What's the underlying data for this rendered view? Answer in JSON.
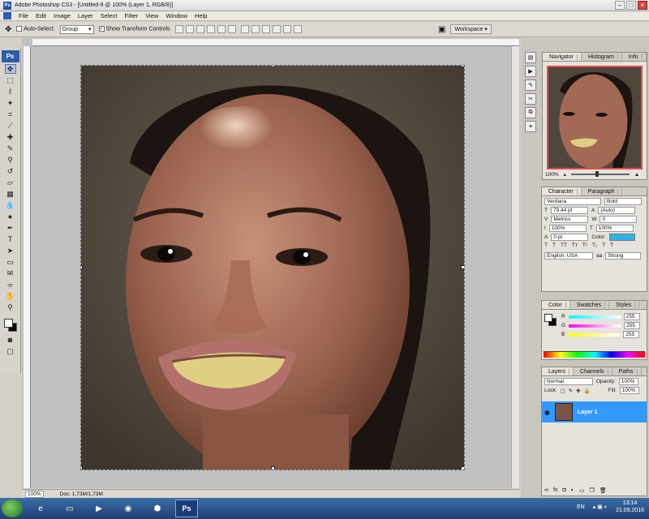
{
  "window": {
    "title": "Adobe Photoshop CS3 - [Untitled-9 @ 100% (Layer 1, RGB/8)]",
    "minimize": "–",
    "maximize": "□",
    "close": "×"
  },
  "menu": [
    "File",
    "Edit",
    "Image",
    "Layer",
    "Select",
    "Filter",
    "View",
    "Window",
    "Help"
  ],
  "options": {
    "auto_select": "Auto-Select:",
    "auto_select_value": "Group",
    "show_transform": "Show Transform Controls",
    "workspace": "Workspace"
  },
  "toolbox": {
    "badge": "Ps"
  },
  "statusbar": {
    "zoom": "100%",
    "doc": "Doc: 1,73M/1,73M"
  },
  "navigator": {
    "tabs": [
      "Navigator",
      "Histogram",
      "Info"
    ],
    "zoom": "100%"
  },
  "character": {
    "tabs": [
      "Character",
      "Paragraph"
    ],
    "font": "Verdana",
    "style": "Bold",
    "size": "79,44 pt",
    "leading": "(Auto)",
    "kerning": "Metrics",
    "tracking": "0",
    "v_scale": "100%",
    "h_scale": "100%",
    "baseline": "0 pt",
    "color_label": "Color:",
    "color_value": "#2bb3ea",
    "language": "English: USA",
    "aa": "Strong",
    "aa_prefix": "aa"
  },
  "color": {
    "tabs": [
      "Color",
      "Swatches",
      "Styles"
    ],
    "r_label": "R",
    "g_label": "G",
    "b_label": "B",
    "r": "255",
    "g": "255",
    "b": "255"
  },
  "layers": {
    "tabs": [
      "Layers",
      "Channels",
      "Paths"
    ],
    "blend": "Normal",
    "opacity_label": "Opacity:",
    "opacity": "100%",
    "lock_label": "Lock:",
    "fill_label": "Fill:",
    "fill": "100%",
    "layer_name": "Layer 1"
  },
  "taskbar": {
    "lang": "EN",
    "time": "13:14",
    "date": "21.09.2016",
    "ps_label": "Ps"
  }
}
